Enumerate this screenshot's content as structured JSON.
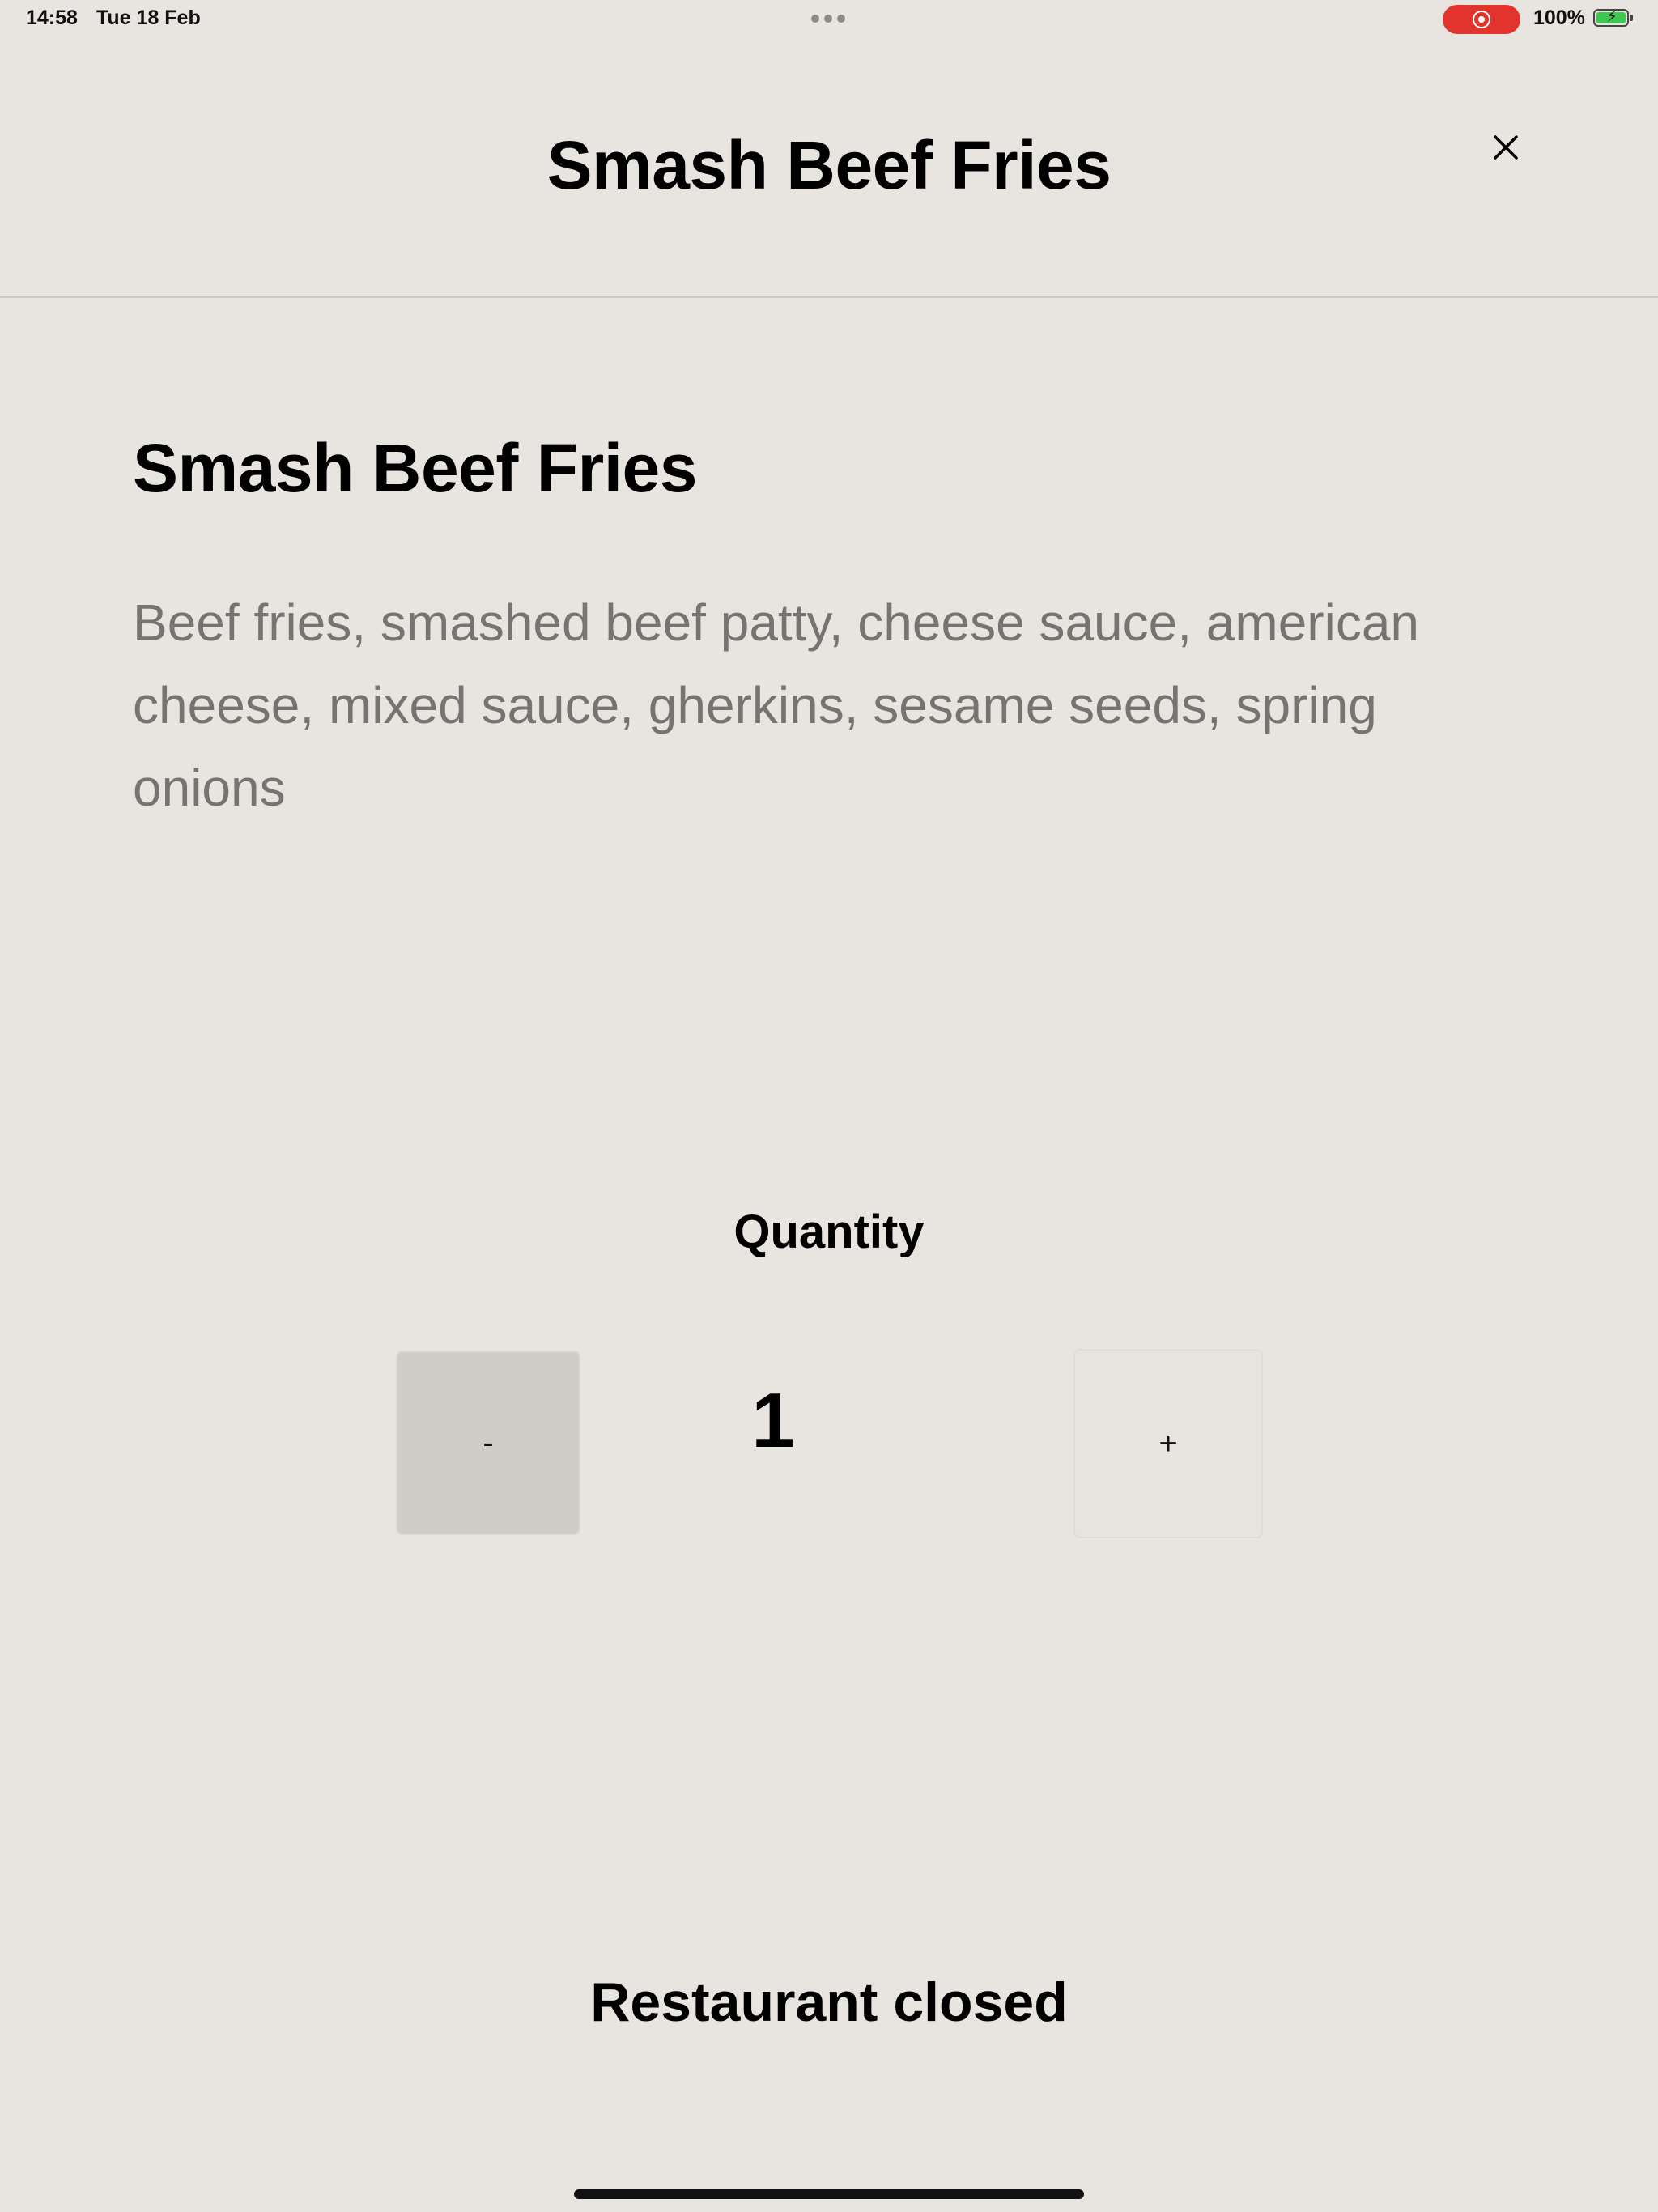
{
  "status_bar": {
    "time": "14:58",
    "date": "Tue 18 Feb",
    "battery_text": "100%",
    "record_color": "#e0342c",
    "battery_color": "#3ec84f"
  },
  "header": {
    "title": "Smash Beef Fries",
    "close_icon": "close-icon"
  },
  "item": {
    "title": "Smash Beef Fries",
    "description": "Beef fries, smashed beef patty, cheese sauce, american cheese, mixed sauce, gherkins, sesame seeds, spring onions"
  },
  "quantity": {
    "label": "Quantity",
    "minus_label": "-",
    "plus_label": "+",
    "value": "1"
  },
  "footer": {
    "status_message": "Restaurant closed"
  }
}
